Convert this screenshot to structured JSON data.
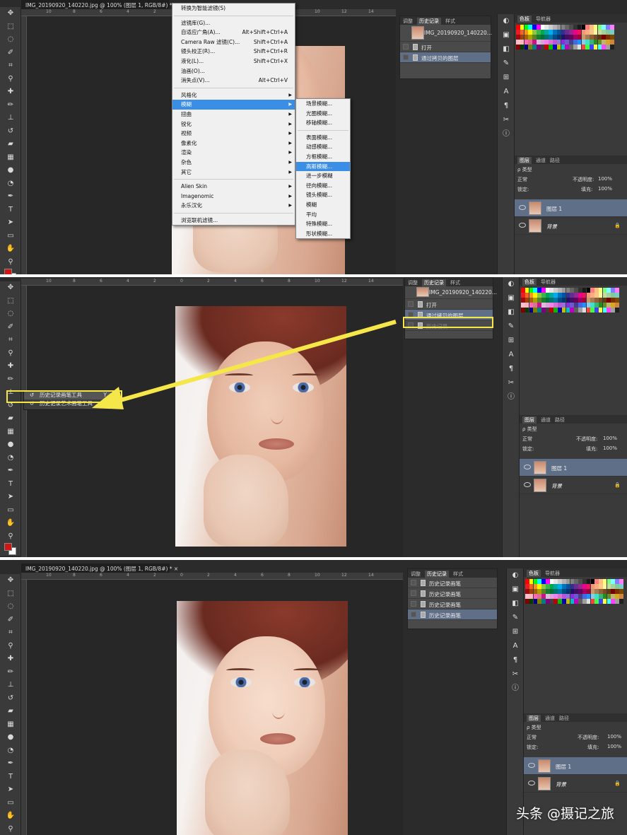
{
  "panel1": {
    "menu": {
      "items": [
        {
          "label": "转换为智能滤镜(S)",
          "shortcut": ""
        },
        {
          "sep": true
        },
        {
          "label": "滤镜库(G)...",
          "shortcut": ""
        },
        {
          "label": "自适应广角(A)...",
          "shortcut": "Alt+Shift+Ctrl+A"
        },
        {
          "label": "Camera Raw 滤镜(C)...",
          "shortcut": "Shift+Ctrl+A"
        },
        {
          "label": "镜头校正(R)...",
          "shortcut": "Shift+Ctrl+R"
        },
        {
          "label": "液化(L)...",
          "shortcut": "Shift+Ctrl+X"
        },
        {
          "label": "油画(O)...",
          "shortcut": ""
        },
        {
          "label": "消失点(V)...",
          "shortcut": "Alt+Ctrl+V"
        },
        {
          "sep": true
        },
        {
          "label": "风格化",
          "sub": true
        },
        {
          "label": "模糊",
          "sub": true,
          "hl": true
        },
        {
          "label": "扭曲",
          "sub": true
        },
        {
          "label": "锐化",
          "sub": true
        },
        {
          "label": "视频",
          "sub": true
        },
        {
          "label": "像素化",
          "sub": true
        },
        {
          "label": "渲染",
          "sub": true
        },
        {
          "label": "杂色",
          "sub": true
        },
        {
          "label": "其它",
          "sub": true
        },
        {
          "sep": true
        },
        {
          "label": "Alien Skin",
          "sub": true
        },
        {
          "label": "Imagenomic",
          "sub": true
        },
        {
          "label": "永乐汉化",
          "sub": true
        },
        {
          "sep": true
        },
        {
          "label": "浏览联机滤镜...",
          "shortcut": ""
        }
      ],
      "submenu": [
        {
          "label": "场景模糊..."
        },
        {
          "label": "光圈模糊..."
        },
        {
          "label": "移轴模糊..."
        },
        {
          "sep": true
        },
        {
          "label": "表面模糊..."
        },
        {
          "label": "动感模糊..."
        },
        {
          "label": "方框模糊..."
        },
        {
          "label": "高斯模糊...",
          "hl": true
        },
        {
          "label": "进一步模糊"
        },
        {
          "label": "径向模糊..."
        },
        {
          "label": "镜头模糊..."
        },
        {
          "label": "模糊"
        },
        {
          "label": "平均"
        },
        {
          "label": "特殊模糊..."
        },
        {
          "label": "形状模糊..."
        }
      ]
    },
    "history_tabs": [
      "调整",
      "历史记录",
      "样式"
    ],
    "history_snapshot": "IMG_20190920_140220...",
    "history": [
      {
        "label": "打开",
        "sel": false
      },
      {
        "label": "通过拷贝的图层",
        "sel": true
      }
    ],
    "swatch_tabs": [
      "色板",
      "导航器"
    ],
    "layers_tabs": [
      "图层",
      "通道",
      "路径"
    ],
    "layer_filter": "ρ 类型",
    "blend_mode": "正常",
    "opacity_label": "不透明度:",
    "opacity": "100%",
    "lock_label": "锁定:",
    "fill_label": "填充:",
    "fill": "100%",
    "layers": [
      {
        "name": "图层 1",
        "sel": true
      },
      {
        "name": "背景",
        "sel": false
      }
    ],
    "ruler_h": [
      "10",
      "8",
      "6",
      "4",
      "2",
      "0",
      "2",
      "4",
      "6",
      "8",
      "10",
      "12",
      "14"
    ]
  },
  "panel2": {
    "history_tabs": [
      "调整",
      "历史记录",
      "样式"
    ],
    "history_snapshot": "IMG_20190920_140220...",
    "history": [
      {
        "label": "打开",
        "sel": false
      },
      {
        "label": "通过拷贝的图层",
        "sel": true
      },
      {
        "label": "历史记录",
        "sel": false,
        "dim": true
      }
    ],
    "flyout": [
      {
        "label": "历史记录画笔工具",
        "key": "Y",
        "hl": true
      },
      {
        "label": "历史记录艺术画笔工具",
        "key": "Y",
        "hl": false
      }
    ],
    "swatch_tabs": [
      "色板",
      "导航器"
    ],
    "layers_tabs": [
      "图层",
      "通道",
      "路径"
    ],
    "layer_filter": "ρ 类型",
    "blend_mode": "正常",
    "opacity_label": "不透明度:",
    "opacity": "100%",
    "lock_label": "锁定:",
    "fill_label": "填充:",
    "fill": "100%",
    "layers": [
      {
        "name": "图层 1",
        "sel": true
      },
      {
        "name": "背景",
        "sel": false
      }
    ],
    "ruler_h": [
      "10",
      "8",
      "6",
      "4",
      "2",
      "0",
      "2",
      "4",
      "6",
      "8",
      "10",
      "12",
      "14"
    ]
  },
  "panel3": {
    "doc_tab": "IMG_20190920_140220.jpg @ 100% (图层 1, RGB/8#) * ×",
    "history_tabs": [
      "调整",
      "历史记录",
      "样式"
    ],
    "history": [
      {
        "label": "历史记录画笔",
        "sel": false
      },
      {
        "label": "历史记录画笔",
        "sel": false
      },
      {
        "label": "历史记录画笔",
        "sel": false
      },
      {
        "label": "历史记录画笔",
        "sel": true
      }
    ],
    "swatch_tabs": [
      "色板",
      "导航器"
    ],
    "layers_tabs": [
      "图层",
      "通道",
      "路径"
    ],
    "layer_filter": "ρ 类型",
    "blend_mode": "正常",
    "opacity_label": "不透明度:",
    "opacity": "100%",
    "lock_label": "锁定:",
    "fill_label": "填充:",
    "fill": "100%",
    "layers": [
      {
        "name": "图层 1",
        "sel": true
      },
      {
        "name": "背景",
        "sel": false
      }
    ],
    "ruler_h": [
      "10",
      "8",
      "6",
      "4",
      "2",
      "0",
      "2",
      "4",
      "6",
      "8",
      "10",
      "12",
      "14"
    ]
  },
  "panel1_doc_tab": "IMG_20190920_140220.jpg @ 100% (图层 1, RGB/8#) * ×",
  "watermark": "头条 @摄记之旅",
  "colors": {
    "foreground": "#d01515",
    "background": "#ffffff",
    "highlight": "#3a8ee6",
    "annotation": "#f5e64a"
  },
  "tool_icons": [
    "move-icon",
    "marquee-icon",
    "lasso-icon",
    "quick-select-icon",
    "crop-icon",
    "eyedropper-icon",
    "healing-icon",
    "brush-icon",
    "stamp-icon",
    "history-brush-icon",
    "eraser-icon",
    "gradient-icon",
    "blur-icon",
    "dodge-icon",
    "pen-icon",
    "type-icon",
    "path-select-icon",
    "shape-icon",
    "hand-icon",
    "zoom-icon"
  ]
}
